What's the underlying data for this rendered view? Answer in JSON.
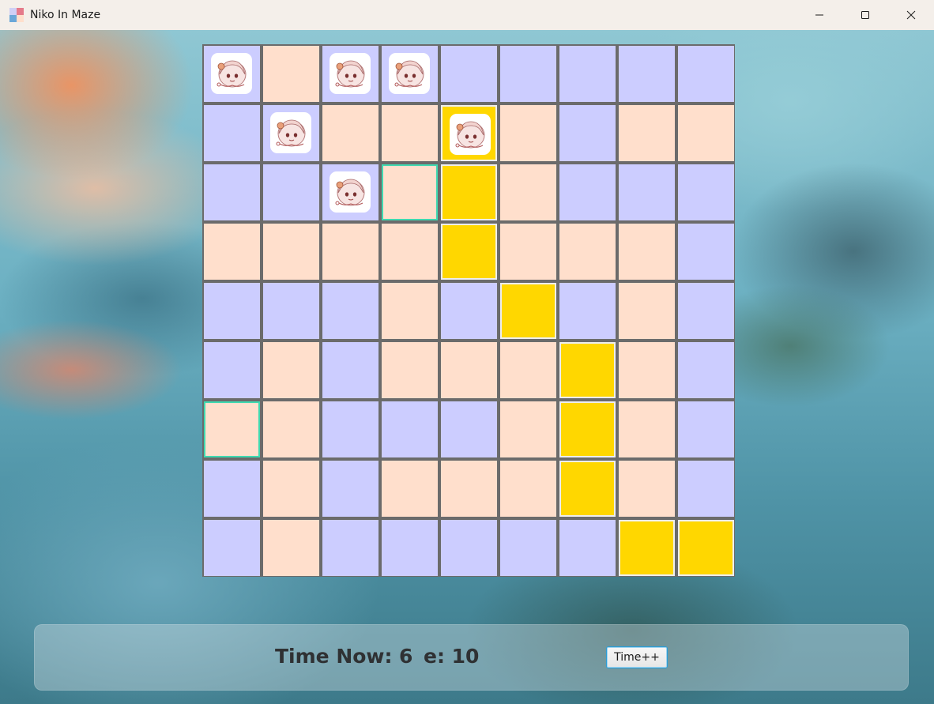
{
  "window": {
    "title": "Niko In Maze",
    "controls": [
      "minimize-icon",
      "maximize-icon",
      "close-icon"
    ]
  },
  "colors": {
    "peach": "#ffdfcc",
    "lavender": "#cccdff",
    "path": "#ffd700",
    "grid_line": "#6b6b6b",
    "highlight": "#3fd9b0"
  },
  "maze": {
    "rows": 9,
    "cols": 9,
    "cells": [
      [
        "L",
        "P",
        "L",
        "L",
        "L",
        "L",
        "L",
        "L",
        "L"
      ],
      [
        "L",
        "L",
        "P",
        "P",
        "Y",
        "P",
        "L",
        "P",
        "P"
      ],
      [
        "L",
        "L",
        "L",
        "P",
        "Y",
        "P",
        "L",
        "L",
        "L"
      ],
      [
        "P",
        "P",
        "P",
        "P",
        "Y",
        "P",
        "P",
        "P",
        "L"
      ],
      [
        "L",
        "L",
        "L",
        "P",
        "L",
        "Y",
        "L",
        "P",
        "L"
      ],
      [
        "L",
        "P",
        "L",
        "P",
        "P",
        "P",
        "Y",
        "P",
        "L"
      ],
      [
        "P",
        "P",
        "L",
        "L",
        "L",
        "P",
        "Y",
        "P",
        "L"
      ],
      [
        "L",
        "P",
        "L",
        "P",
        "P",
        "P",
        "Y",
        "P",
        "L"
      ],
      [
        "L",
        "P",
        "L",
        "L",
        "L",
        "L",
        "L",
        "Y",
        "Y"
      ]
    ],
    "niko_positions": [
      [
        0,
        0
      ],
      [
        0,
        2
      ],
      [
        0,
        3
      ],
      [
        1,
        1
      ],
      [
        1,
        4
      ],
      [
        2,
        2
      ]
    ],
    "highlighted_cells": [
      [
        2,
        3
      ],
      [
        6,
        0
      ]
    ]
  },
  "status": {
    "time_label": "Time Now:",
    "time_value": "6",
    "energy_label": "e: 10",
    "time_button": "Time++"
  }
}
